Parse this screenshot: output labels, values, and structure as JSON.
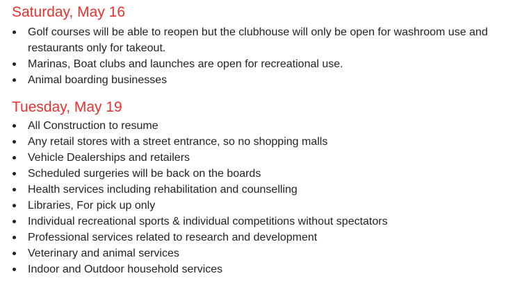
{
  "sections": [
    {
      "heading": "Saturday, May 16",
      "items": [
        "Golf courses will be able to reopen but the clubhouse will only be open for washroom use and restaurants only for takeout.",
        "Marinas, Boat clubs and launches are open for recreational use.",
        "Animal boarding businesses"
      ]
    },
    {
      "heading": "Tuesday, May 19",
      "items": [
        "All Construction to resume",
        "Any retail stores with a street entrance, so no shopping malls",
        "Vehicle Dealerships and retailers",
        "Scheduled surgeries will be back on the boards",
        "Health services including rehabilitation and counselling",
        "Libraries, For pick up only",
        "Individual recreational sports & individual competitions without spectators",
        "Professional services related to research and development",
        "Veterinary and animal services",
        "Indoor and Outdoor household services"
      ]
    }
  ],
  "colors": {
    "heading": "#e8312e",
    "text": "#222222"
  }
}
